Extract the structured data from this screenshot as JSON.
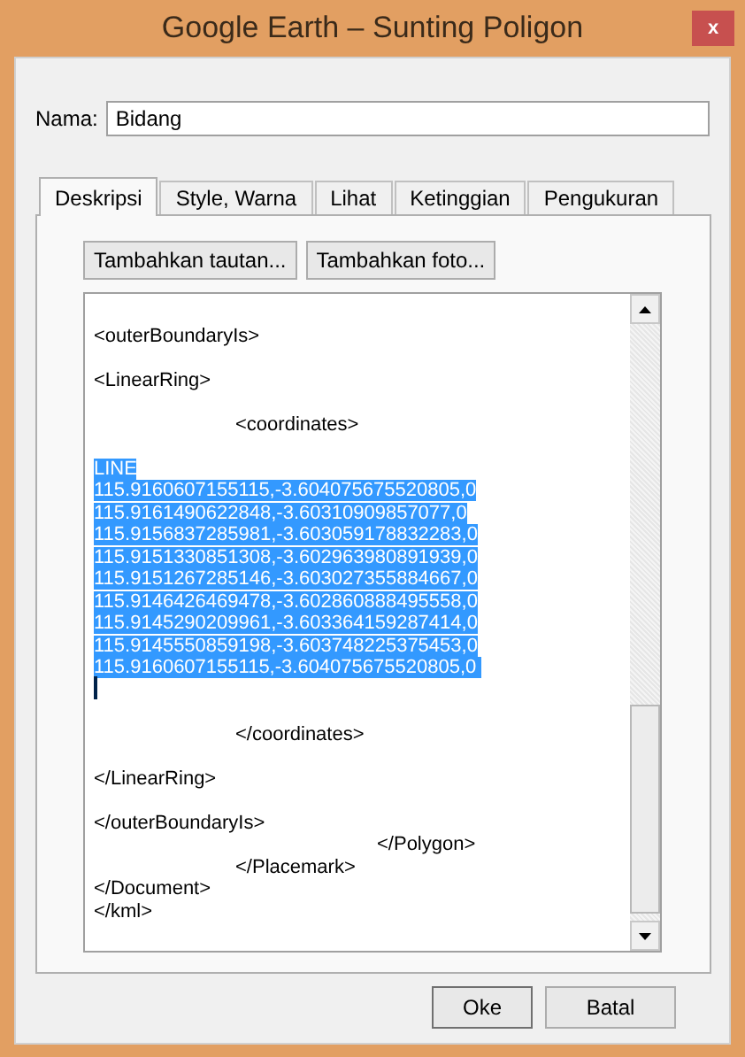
{
  "window": {
    "title": "Google Earth – Sunting Poligon",
    "close": "x"
  },
  "name_field": {
    "label": "Nama:",
    "value": "Bidang"
  },
  "tabs": [
    {
      "label": "Deskripsi",
      "selected": true
    },
    {
      "label": "Style, Warna",
      "selected": false
    },
    {
      "label": "Lihat",
      "selected": false
    },
    {
      "label": "Ketinggian",
      "selected": false
    },
    {
      "label": "Pengukuran",
      "selected": false
    }
  ],
  "panel_buttons": [
    "Tambahkan tautan...",
    "Tambahkan foto..."
  ],
  "editor_lines": [
    {
      "kind": "blank"
    },
    {
      "kind": "text",
      "text": "<outerBoundaryIs>",
      "selected": false
    },
    {
      "kind": "blank"
    },
    {
      "kind": "text",
      "text": "<LinearRing>",
      "selected": false
    },
    {
      "kind": "blank"
    },
    {
      "kind": "text",
      "text": "\t<coordinates>",
      "selected": false
    },
    {
      "kind": "blank"
    },
    {
      "kind": "text",
      "text": "LINE",
      "selected": true
    },
    {
      "kind": "text",
      "text": "115.9160607155115,-3.604075675520805,0",
      "selected": true
    },
    {
      "kind": "text",
      "text": "115.9161490622848,-3.60310909857077,0",
      "selected": true
    },
    {
      "kind": "text",
      "text": "115.9156837285981,-3.603059178832283,0",
      "selected": true
    },
    {
      "kind": "text",
      "text": "115.9151330851308,-3.602963980891939,0",
      "selected": true
    },
    {
      "kind": "text",
      "text": "115.9151267285146,-3.603027355884667,0",
      "selected": true
    },
    {
      "kind": "text",
      "text": "115.9146426469478,-3.602860888495558,0",
      "selected": true
    },
    {
      "kind": "text",
      "text": "115.9145290209961,-3.603364159287414,0",
      "selected": true
    },
    {
      "kind": "text",
      "text": "115.9145550859198,-3.603748225375453,0",
      "selected": true
    },
    {
      "kind": "text",
      "text": "115.9160607155115,-3.604075675520805,0 ",
      "selected": true
    },
    {
      "kind": "caret"
    },
    {
      "kind": "blank"
    },
    {
      "kind": "text",
      "text": "\t</coordinates>",
      "selected": false
    },
    {
      "kind": "blank"
    },
    {
      "kind": "text",
      "text": "</LinearRing>",
      "selected": false
    },
    {
      "kind": "blank"
    },
    {
      "kind": "text",
      "text": "</outerBoundaryIs>",
      "selected": false
    },
    {
      "kind": "text",
      "text": "\t\t</Polygon>",
      "selected": false
    },
    {
      "kind": "text",
      "text": "\t</Placemark>",
      "selected": false
    },
    {
      "kind": "text",
      "text": "</Document>",
      "selected": false
    },
    {
      "kind": "text",
      "text": "</kml>",
      "selected": false
    }
  ],
  "footer_buttons": [
    "Oke",
    "Batal"
  ]
}
